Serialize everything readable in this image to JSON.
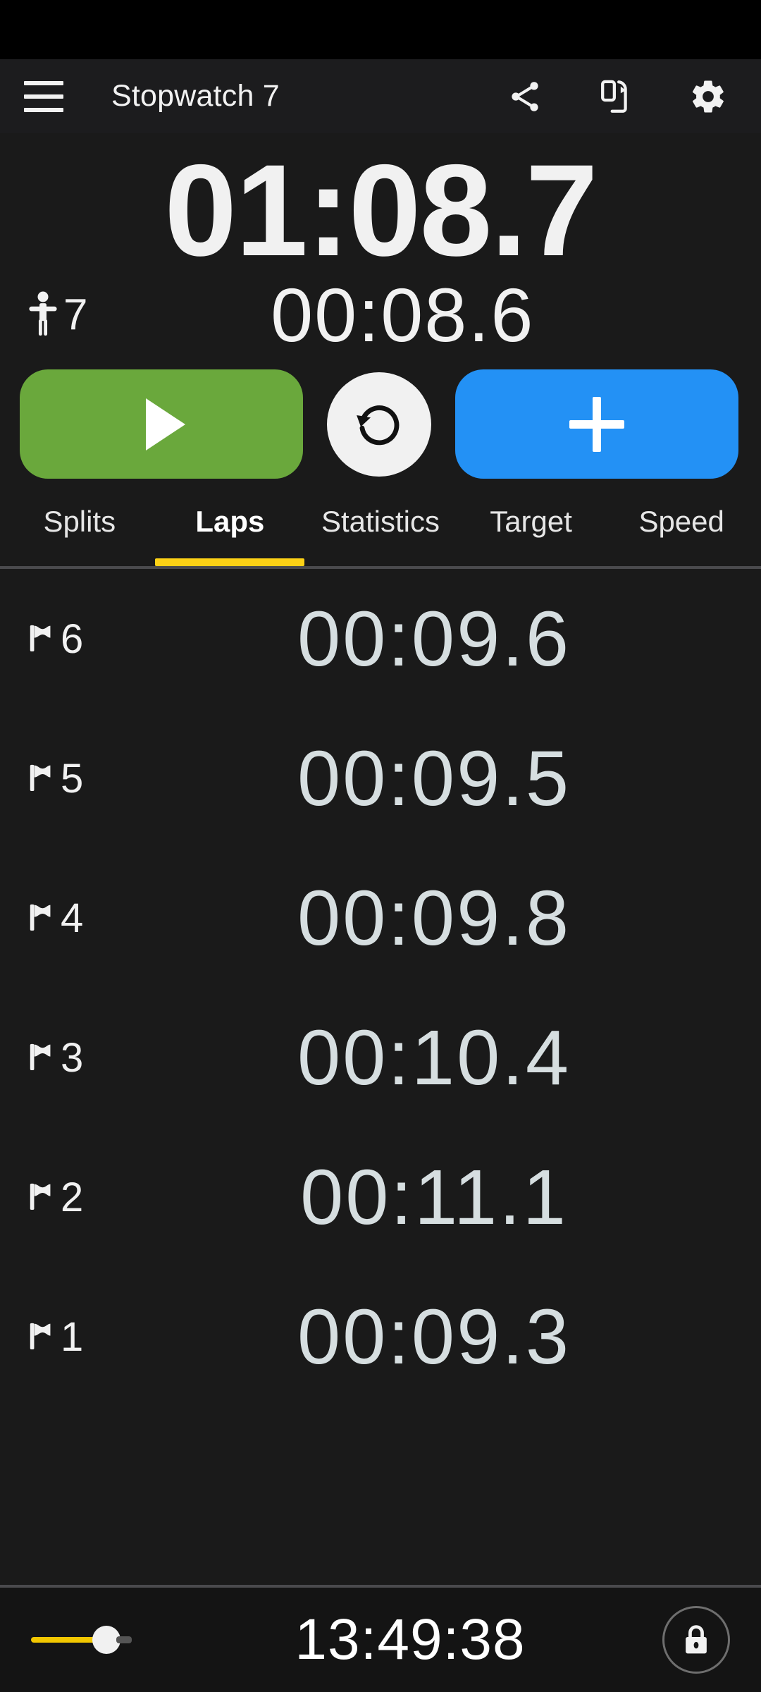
{
  "app": {
    "title": "Stopwatch 7",
    "background": "#1a1a1a",
    "accent_yellow": "#FCD116",
    "accent_green": "#6AA83C",
    "accent_blue": "#2391F5"
  },
  "appbar": {
    "menu_icon": "hamburger-menu-icon",
    "actions": [
      {
        "icon": "share-icon",
        "name": "share-button"
      },
      {
        "icon": "screen-rotate-icon",
        "name": "rotate-screen-button"
      },
      {
        "icon": "gear-icon",
        "name": "settings-button"
      }
    ]
  },
  "timer": {
    "main_time": "01:08.7",
    "person_icon": "person-standing-icon",
    "person_count": "7",
    "current_lap_time": "00:08.6"
  },
  "controls": {
    "start_label": "play-icon",
    "start_name": "start-button",
    "reset_label": "reset-rotate-icon",
    "reset_name": "reset-button",
    "add_label": "plus-icon",
    "add_name": "add-lap-button"
  },
  "tabs": {
    "active_index": 1,
    "items": [
      {
        "label": "Splits"
      },
      {
        "label": "Laps"
      },
      {
        "label": "Statistics"
      },
      {
        "label": "Target"
      },
      {
        "label": "Speed"
      }
    ]
  },
  "laps": [
    {
      "number": "6",
      "time": "00:09.6"
    },
    {
      "number": "5",
      "time": "00:09.5"
    },
    {
      "number": "4",
      "time": "00:09.8"
    },
    {
      "number": "3",
      "time": "00:10.4"
    },
    {
      "number": "2",
      "time": "00:11.1"
    },
    {
      "number": "1",
      "time": "00:09.3"
    }
  ],
  "bottom": {
    "brightness_icon": "brightness-slider",
    "clock": "13:49:38",
    "lock_icon": "lock-icon"
  }
}
